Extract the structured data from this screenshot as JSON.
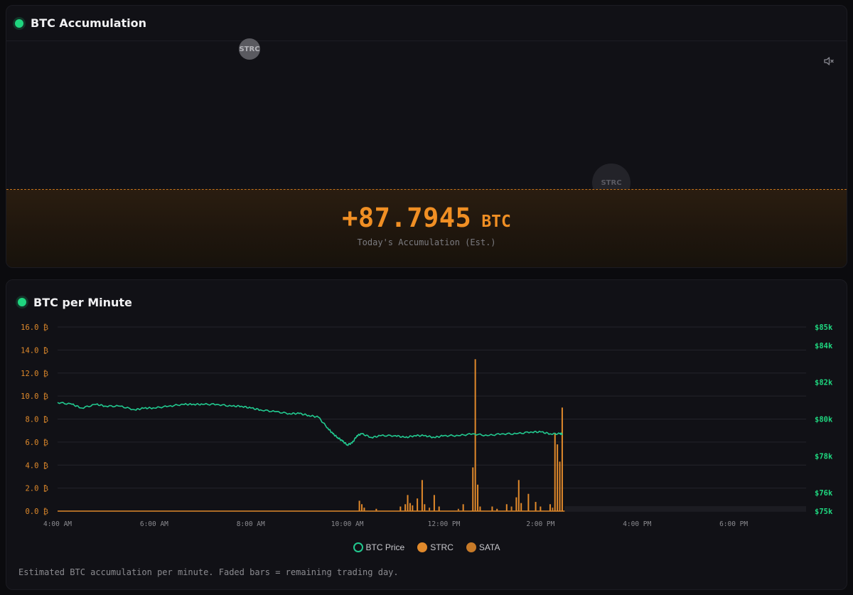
{
  "top_panel": {
    "title": "BTC Accumulation",
    "bubbles": [
      "STRC",
      "STRC"
    ],
    "mute_icon": "speaker-muted-icon",
    "accumulation_value": "+87.7945",
    "accumulation_unit": "BTC",
    "accumulation_label": "Today's Accumulation (Est.)"
  },
  "bottom_panel": {
    "title": "BTC per Minute",
    "footnote": "Estimated BTC accumulation per minute. Faded bars = remaining trading day."
  },
  "colors": {
    "accent_green": "#1fd67f",
    "price_line": "#22c98f",
    "strc": "#e0892b",
    "sata": "#c77a28",
    "left_axis_text": "#e08a2b",
    "right_axis_text": "#1fd67f"
  },
  "chart_data": {
    "type": "bar+line",
    "title": "BTC per Minute",
    "x_ticks": [
      "4:00 AM",
      "6:00 AM",
      "8:00 AM",
      "10:00 AM",
      "12:00 PM",
      "2:00 PM",
      "4:00 PM",
      "6:00 PM"
    ],
    "x_range_hours": [
      4.0,
      19.5
    ],
    "y_left": {
      "ticks": [
        "0.0 ₿",
        "2.0 ₿",
        "4.0 ₿",
        "6.0 ₿",
        "8.0 ₿",
        "10.0 ₿",
        "12.0 ₿",
        "14.0 ₿",
        "16.0 ₿"
      ],
      "range": [
        0,
        16
      ]
    },
    "y_right": {
      "ticks": [
        "$75k",
        "$76k",
        "$78k",
        "$80k",
        "$82k",
        "$84k",
        "$85k"
      ],
      "tick_values": [
        75000,
        76000,
        78000,
        80000,
        82000,
        84000,
        85000
      ],
      "range": [
        75000,
        85000
      ]
    },
    "legend": [
      "BTC Price",
      "STRC",
      "SATA"
    ],
    "grid": true,
    "legend_position": "bottom",
    "price_series": {
      "name": "BTC Price",
      "x_hours": [
        4.0,
        4.3,
        4.5,
        4.8,
        5.0,
        5.3,
        5.6,
        5.8,
        6.0,
        6.3,
        6.6,
        6.8,
        7.0,
        7.3,
        7.6,
        7.8,
        8.0,
        8.2,
        8.5,
        8.8,
        9.0,
        9.2,
        9.4,
        9.6,
        9.7,
        9.8,
        9.9,
        10.0,
        10.1,
        10.2,
        10.3,
        10.5,
        10.7,
        11.0,
        11.2,
        11.4,
        11.6,
        11.8,
        12.0,
        12.3,
        12.6,
        12.9,
        13.2,
        13.5,
        13.8,
        14.0,
        14.2,
        14.4,
        14.45
      ],
      "y": [
        80900,
        80800,
        80600,
        80800,
        80700,
        80700,
        80500,
        80600,
        80600,
        80700,
        80800,
        80800,
        80800,
        80800,
        80700,
        80700,
        80600,
        80500,
        80400,
        80300,
        80300,
        80200,
        80100,
        79500,
        79200,
        79000,
        78800,
        78600,
        78700,
        79100,
        79200,
        79000,
        79100,
        79100,
        79000,
        79100,
        79100,
        79000,
        79100,
        79100,
        79200,
        79100,
        79200,
        79200,
        79300,
        79300,
        79200,
        79200,
        79200
      ]
    },
    "strc_bars": {
      "name": "STRC",
      "x_hours": [
        10.25,
        10.3,
        10.35,
        10.6,
        11.1,
        11.2,
        11.25,
        11.3,
        11.35,
        11.45,
        11.55,
        11.6,
        11.8,
        11.9,
        12.4,
        12.6,
        12.65,
        12.7,
        12.75,
        13.0,
        13.1,
        13.3,
        13.5,
        13.55,
        13.6,
        13.75,
        13.9,
        14.0,
        14.2,
        14.3,
        14.35,
        14.4,
        14.45
      ],
      "values": [
        0.9,
        0.6,
        0.3,
        0.2,
        0.4,
        0.6,
        1.4,
        0.7,
        0.5,
        1.1,
        2.7,
        0.6,
        1.4,
        0.4,
        0.6,
        3.8,
        13.2,
        2.3,
        0.4,
        0.4,
        0.2,
        0.6,
        1.2,
        2.7,
        0.7,
        1.5,
        0.8,
        0.4,
        0.6,
        6.8,
        5.8,
        4.3,
        9.0
      ]
    },
    "sata_bars": {
      "name": "SATA",
      "x_hours": [
        11.7,
        12.3,
        13.4,
        14.25
      ],
      "values": [
        0.3,
        0.2,
        0.4,
        0.3
      ]
    },
    "remaining_day_from_hour": 14.5
  }
}
